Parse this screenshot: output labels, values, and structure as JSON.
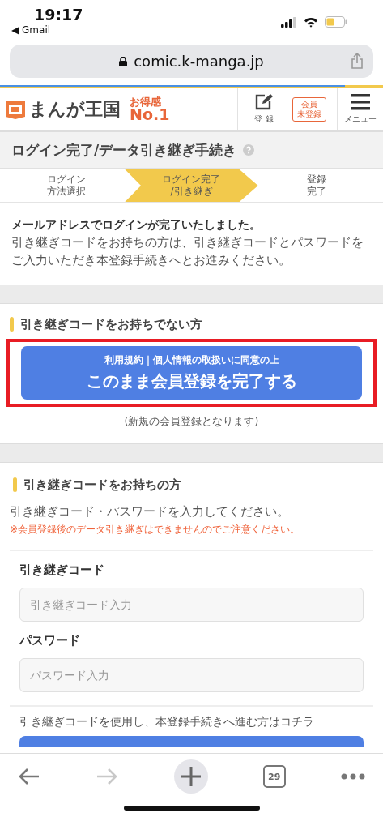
{
  "status_bar": {
    "time": "19:17",
    "back_app": "◀ Gmail"
  },
  "address_bar": {
    "url": "comic.k-manga.jp"
  },
  "header": {
    "logo": "まんが王国",
    "badge_top": "お得感",
    "badge_bottom": "No.1",
    "register_label": "登 録",
    "member_badge": [
      "会員",
      "未登録"
    ],
    "menu_label": "メニュー"
  },
  "page_title": "ログイン完了/データ引き継ぎ手続き",
  "steps": [
    {
      "label_lines": [
        "ログイン",
        "方法選択"
      ],
      "selected": false
    },
    {
      "label_lines": [
        "ログイン完了",
        "/引き継ぎ"
      ],
      "selected": true
    },
    {
      "label_lines": [
        "登録",
        "完了"
      ],
      "selected": false
    }
  ],
  "message": {
    "heading": "メールアドレスでログインが完了いたしました。",
    "body": "引き継ぎコードをお持ちの方は、引き継ぎコードとパスワードをご入力いただき本登録手続きへとお進みください。"
  },
  "no_code_section": {
    "heading": "引き継ぎコードをお持ちでない方",
    "button_sub": "利用規約｜個人情報の取扱いに同意の上",
    "button_main": "このまま会員登録を完了する",
    "highlighted": true,
    "note": "(新規の会員登録となります)"
  },
  "code_section": {
    "heading": "引き継ぎコードをお持ちの方",
    "instruction": "引き継ぎコード・パスワードを入力してください。",
    "warning": "※会員登録後のデータ引き継ぎはできませんのでご注意ください。",
    "fields": [
      {
        "label": "引き継ぎコード",
        "placeholder": "引き継ぎコード入力"
      },
      {
        "label": "パスワード",
        "placeholder": "パスワード入力"
      }
    ],
    "proceed_text": "引き継ぎコードを使用し、本登録手続きへ進む方はコチラ"
  },
  "toolbar": {
    "back_disabled": false,
    "forward_disabled": true,
    "tab_count": "29"
  }
}
